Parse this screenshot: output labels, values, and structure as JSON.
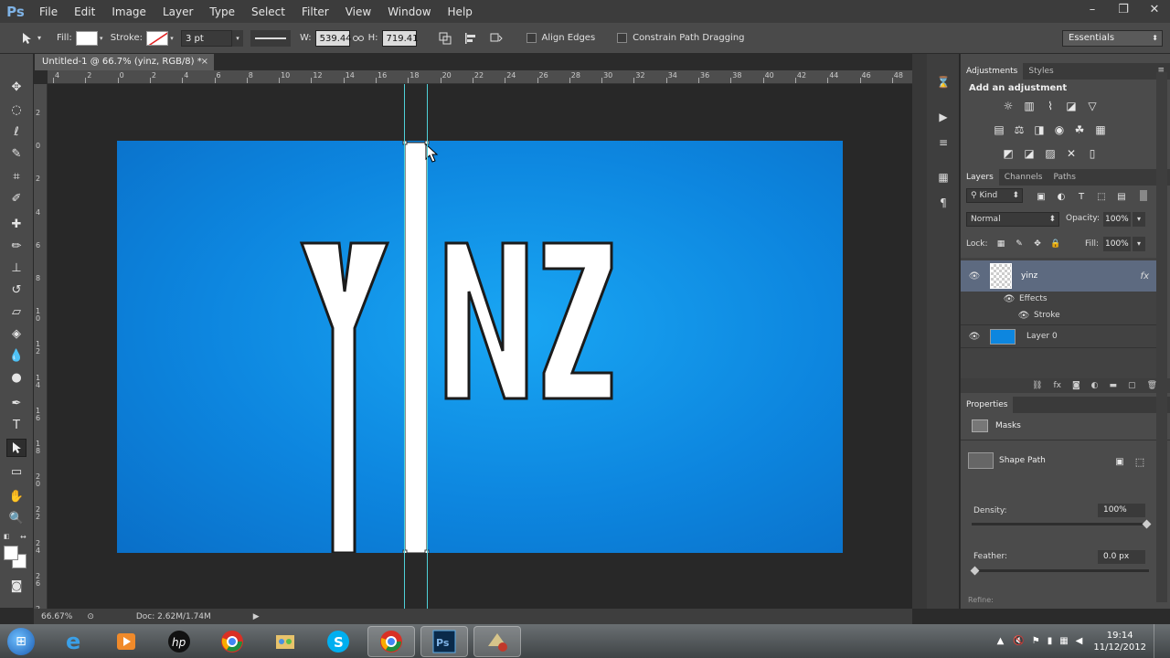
{
  "app": {
    "logo": "Ps",
    "menu": [
      "File",
      "Edit",
      "Image",
      "Layer",
      "Type",
      "Select",
      "Filter",
      "View",
      "Window",
      "Help"
    ],
    "win_controls": [
      "–",
      "❐",
      "✕"
    ]
  },
  "options": {
    "fill_label": "Fill:",
    "stroke_label": "Stroke:",
    "stroke_width": "3 pt",
    "w_label": "W:",
    "w_value": "539.44",
    "h_label": "H:",
    "h_value": "719.41",
    "align_edges": "Align Edges",
    "constrain": "Constrain Path Dragging",
    "workspace": "Essentials",
    "fill_color": "#ffffff"
  },
  "document": {
    "tab_title": "Untitled-1 @ 66.7% (yinz, RGB/8) *",
    "tab_close": "×",
    "zoom": "66.67%",
    "doc_info": "Doc: 2.62M/1.74M"
  },
  "rulers": {
    "top": [
      "4",
      "2",
      "0",
      "2",
      "4",
      "6",
      "8",
      "10",
      "12",
      "14",
      "16",
      "18",
      "20",
      "22",
      "24",
      "26",
      "28",
      "30",
      "32",
      "34",
      "36",
      "38",
      "40",
      "42",
      "44",
      "46",
      "48"
    ],
    "left": [
      "2",
      "0",
      "2",
      "4",
      "6",
      "8",
      "1 0",
      "1 2",
      "1 4",
      "1 6",
      "1 8",
      "2 0",
      "2 2",
      "2 4",
      "2 6",
      "2 8"
    ]
  },
  "artwork": {
    "canvas_color": "#0d86df",
    "text": "YINZ"
  },
  "adjustments": {
    "tabs": [
      "Adjustments",
      "Styles"
    ],
    "heading": "Add an adjustment"
  },
  "layers": {
    "tabs": [
      "Layers",
      "Channels",
      "Paths"
    ],
    "kind": "Kind",
    "blend_mode": "Normal",
    "opacity_label": "Opacity:",
    "opacity_value": "100%",
    "lock_label": "Lock:",
    "fill_label": "Fill:",
    "fill_value": "100%",
    "items": [
      {
        "name": "yinz",
        "fx": "fx"
      },
      {
        "name": "Effects"
      },
      {
        "name": "Stroke"
      },
      {
        "name": "Layer 0"
      }
    ]
  },
  "properties": {
    "tab": "Properties",
    "masks": "Masks",
    "shape_path": "Shape Path",
    "density_label": "Density:",
    "density_value": "100%",
    "density": 1.0,
    "feather_label": "Feather:",
    "feather_value": "0.0 px",
    "feather": 0.0,
    "refine_label": "Refine:"
  },
  "taskbar": {
    "time": "19:14",
    "date": "11/12/2012"
  }
}
